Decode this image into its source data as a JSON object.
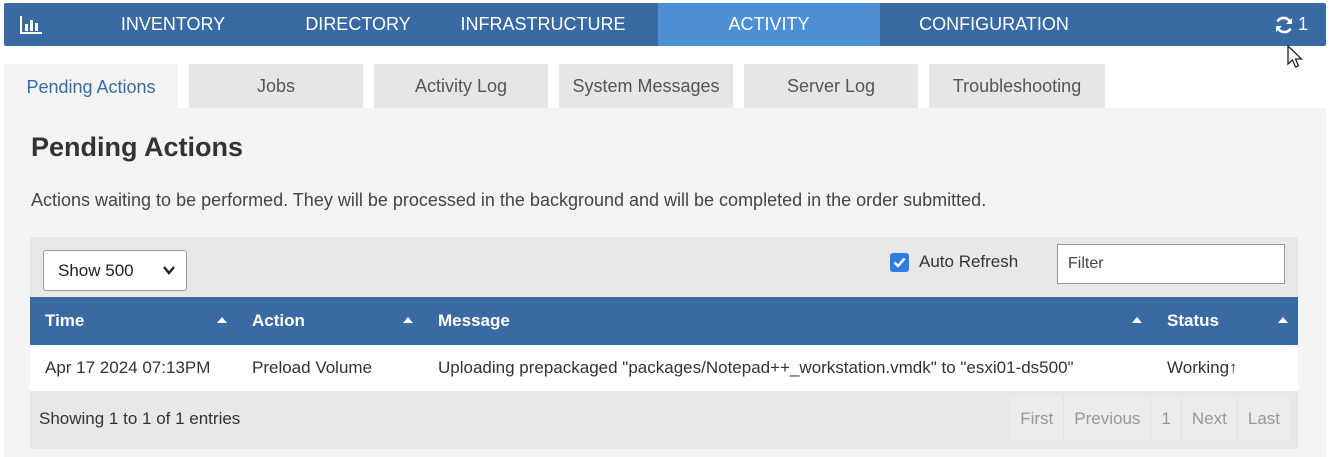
{
  "nav": {
    "items": [
      {
        "label": "INVENTORY",
        "active": false
      },
      {
        "label": "DIRECTORY",
        "active": false
      },
      {
        "label": "INFRASTRUCTURE",
        "active": false
      },
      {
        "label": "ACTIVITY",
        "active": true
      },
      {
        "label": "CONFIGURATION",
        "active": false
      }
    ],
    "refresh_count": "1",
    "logo_icon": "bar-chart-icon",
    "refresh_icon": "refresh-icon"
  },
  "tabs": [
    {
      "label": "Pending Actions",
      "active": true
    },
    {
      "label": "Jobs",
      "active": false
    },
    {
      "label": "Activity Log",
      "active": false
    },
    {
      "label": "System Messages",
      "active": false
    },
    {
      "label": "Server Log",
      "active": false
    },
    {
      "label": "Troubleshooting",
      "active": false
    }
  ],
  "main": {
    "title": "Pending Actions",
    "description": "Actions waiting to be performed. They will be processed in the background and will be completed in the order submitted."
  },
  "controls": {
    "page_size": "Show 500",
    "auto_refresh_label": "Auto Refresh",
    "auto_refresh_checked": true,
    "filter_placeholder": "Filter"
  },
  "table": {
    "columns": [
      "Time",
      "Action",
      "Message",
      "Status"
    ],
    "rows": [
      {
        "time": "Apr 17 2024 07:13PM",
        "action": "Preload Volume",
        "message": "Uploading prepackaged \"packages/Notepad++_workstation.vmdk\" to \"esxi01-ds500\"",
        "status": "Working↑"
      }
    ]
  },
  "footer": {
    "info": "Showing 1 to 1 of 1 entries",
    "pager": {
      "first": "First",
      "previous": "Previous",
      "page": "1",
      "next": "Next",
      "last": "Last"
    }
  },
  "colors": {
    "nav_bg": "#3a6aa3",
    "nav_active": "#4d8fd4",
    "panel_bg": "#f4f4f4",
    "checkbox": "#2f7de1"
  }
}
